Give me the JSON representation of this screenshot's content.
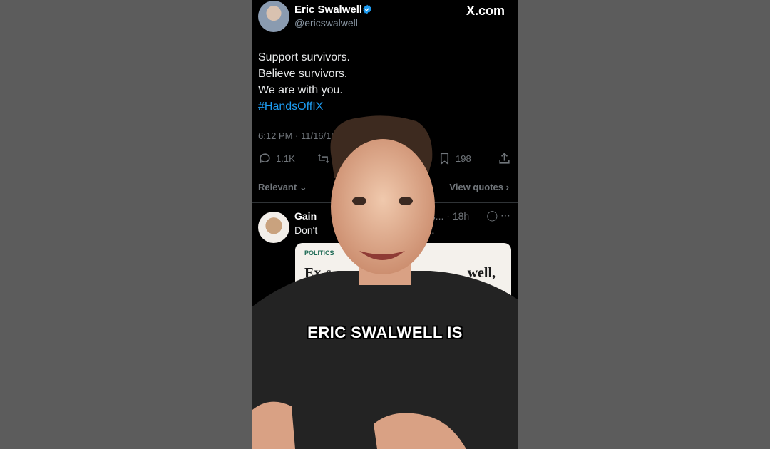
{
  "tweet": {
    "author_name": "Eric Swalwell",
    "handle": "@ericswalwell",
    "site_label": "X.com",
    "lines": [
      "Support survivors.",
      "Believe survivors.",
      "We are with you."
    ],
    "hashtag": "#HandsOffIX",
    "timestamp": "6:12 PM · 11/16/18",
    "replies_count": "1.1K",
    "bookmarks_count": "198"
  },
  "replies_header": {
    "sort_label": "Relevant",
    "view_quotes_label": "View quotes"
  },
  "reply": {
    "author_name": "Gain",
    "handle_fragment": "esIs...",
    "age": "18h",
    "text_start": "Don't",
    "text_end": "her.",
    "card_category": "POLITICS",
    "card_headline_start": "Ex-s",
    "card_headline_end": "well,"
  },
  "video": {
    "caption": "ERIC SWALWELL IS"
  },
  "colors": {
    "background": "#5c5c5c",
    "phone": "#000000",
    "link_blue": "#1d9bf0",
    "muted": "#71767b"
  },
  "icons": [
    "verified-badge-icon",
    "reply-icon",
    "retweet-icon",
    "bookmark-icon",
    "share-icon",
    "chevron-down-icon",
    "chevron-right-icon",
    "grok-icon",
    "more-icon"
  ]
}
